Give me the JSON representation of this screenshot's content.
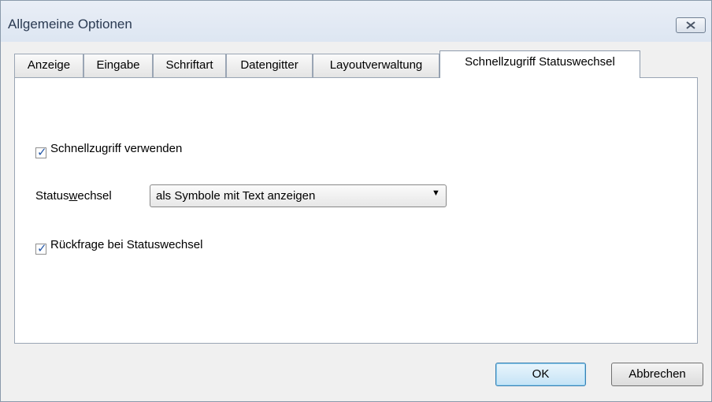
{
  "window": {
    "title": "Allgemeine Optionen",
    "close_icon": "close-icon"
  },
  "tabs": [
    {
      "label": "Anzeige",
      "active": false
    },
    {
      "label": "Eingabe",
      "active": false
    },
    {
      "label": "Schriftart",
      "active": false
    },
    {
      "label": "Datengitter",
      "active": false
    },
    {
      "label": "Layoutverwaltung",
      "active": false
    },
    {
      "label": "Schnellzugriff Statuswechsel",
      "active": true
    }
  ],
  "panel": {
    "use_quick_access": {
      "label": "Schnellzugriff verwenden",
      "checked": true
    },
    "status_change": {
      "label_prefix": "Status",
      "label_mnemonic": "w",
      "label_suffix": "echsel",
      "selected": "als Symbole mit Text anzeigen"
    },
    "confirm_status_change": {
      "label": "Rückfrage bei Statuswechsel",
      "checked": true
    }
  },
  "buttons": {
    "ok": "OK",
    "cancel": "Abbrechen"
  }
}
